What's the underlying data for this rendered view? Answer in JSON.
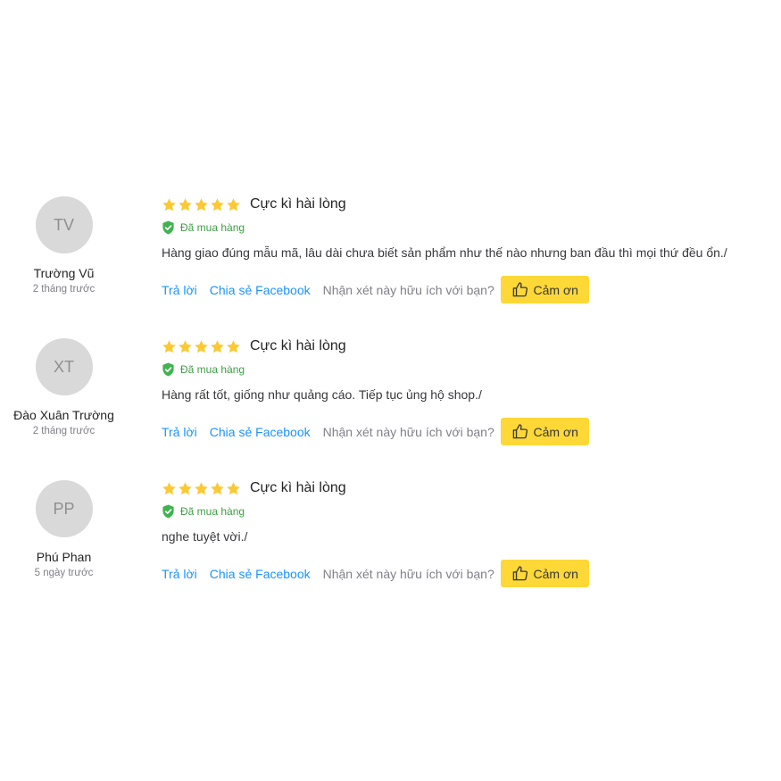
{
  "reviews": [
    {
      "initials": "TV",
      "name": "Trường Vũ",
      "time": "2 tháng trước",
      "rating": 5,
      "rating_text": "Cực kì hài lòng",
      "verified_text": "Đã mua hàng",
      "text": "Hàng giao đúng mẫu mã, lâu dài chưa biết sản phẩm như thế nào nhưng ban đầu thì mọi thứ đều ổn./"
    },
    {
      "initials": "XT",
      "name": "Đào Xuân Trường",
      "time": "2 tháng trước",
      "rating": 5,
      "rating_text": "Cực kì hài lòng",
      "verified_text": "Đã mua hàng",
      "text": "Hàng rất tốt, giống như quảng cáo. Tiếp tục ủng hộ shop./"
    },
    {
      "initials": "PP",
      "name": "Phú Phan",
      "time": "5 ngày trước",
      "rating": 5,
      "rating_text": "Cực kì hài lòng",
      "verified_text": "Đã mua hàng",
      "text": "nghe tuyệt vời./"
    }
  ],
  "actions": {
    "reply_label": "Trả lời",
    "share_label": "Chia sẻ Facebook",
    "helpful_question": "Nhận xét này hữu ích với bạn?",
    "thanks_label": "Cảm ơn"
  },
  "colors": {
    "star": "#fdc831",
    "link": "#1a94ff",
    "verified": "#3f9d44",
    "thanks_button": "#fdd836"
  },
  "icons": {
    "star": "star-icon",
    "verified": "shield-check-icon",
    "thanks": "thumbs-up-icon"
  }
}
